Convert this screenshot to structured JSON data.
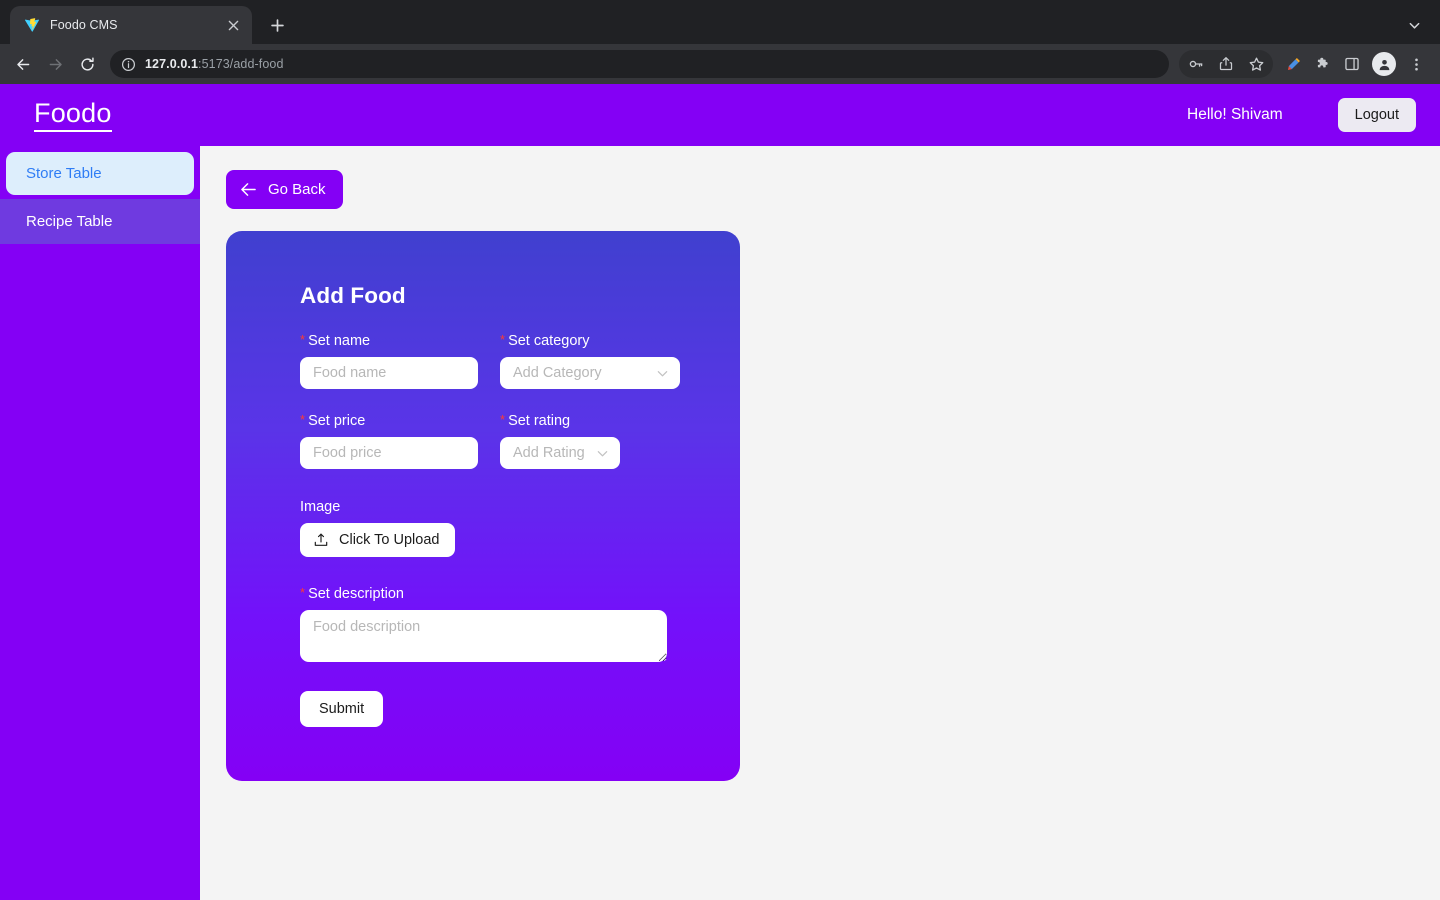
{
  "browser": {
    "tab": {
      "title": "Foodo CMS",
      "favicon": "vite-logo-icon",
      "close_icon": "close-icon"
    },
    "new_tab_icon": "plus-icon",
    "tab_search_icon": "chevron-down-icon",
    "nav": {
      "back_icon": "arrow-left-icon",
      "forward_icon": "arrow-right-icon",
      "reload_icon": "reload-icon"
    },
    "omnibox": {
      "info_icon": "info-circle-icon",
      "url_host": "127.0.0.1",
      "url_rest": ":5173/add-food"
    },
    "toolbar_icons": [
      {
        "name": "password-key-icon"
      },
      {
        "name": "share-icon"
      },
      {
        "name": "bookmark-star-icon"
      },
      {
        "name": "pen-highlighter-icon"
      },
      {
        "name": "extensions-puzzle-icon"
      },
      {
        "name": "side-panel-icon"
      },
      {
        "name": "profile-avatar-icon"
      },
      {
        "name": "more-vertical-icon"
      }
    ]
  },
  "appbar": {
    "brand": "Foodo",
    "greeting": "Hello! Shivam",
    "logout_label": "Logout",
    "bg_color": "#8400f5"
  },
  "sidebar": {
    "items": [
      {
        "label": "Store Table",
        "active": true
      },
      {
        "label": "Recipe Table",
        "active": false
      }
    ],
    "active_bg": "#ddeefc",
    "active_text": "#2f7df5"
  },
  "content": {
    "go_back": {
      "label": "Go Back",
      "icon": "arrow-left-icon"
    }
  },
  "form": {
    "title": "Add Food",
    "required_marker": "*",
    "fields": {
      "name": {
        "label": "Set name",
        "placeholder": "Food name",
        "value": "",
        "required": true
      },
      "category": {
        "label": "Set category",
        "placeholder": "Add Category",
        "value": "",
        "required": true,
        "chevron": "chevron-down-icon"
      },
      "price": {
        "label": "Set price",
        "placeholder": "Food price",
        "value": "",
        "required": true
      },
      "rating": {
        "label": "Set rating",
        "placeholder": "Add Rating",
        "value": "",
        "required": true,
        "chevron": "chevron-down-icon"
      },
      "image": {
        "label": "Image",
        "button_label": "Click To Upload",
        "icon": "upload-icon",
        "required": false
      },
      "description": {
        "label": "Set description",
        "placeholder": "Food description",
        "value": "",
        "required": true
      }
    },
    "submit_label": "Submit",
    "gradient_from": "#4040cf",
    "gradient_to": "#8400f5"
  }
}
